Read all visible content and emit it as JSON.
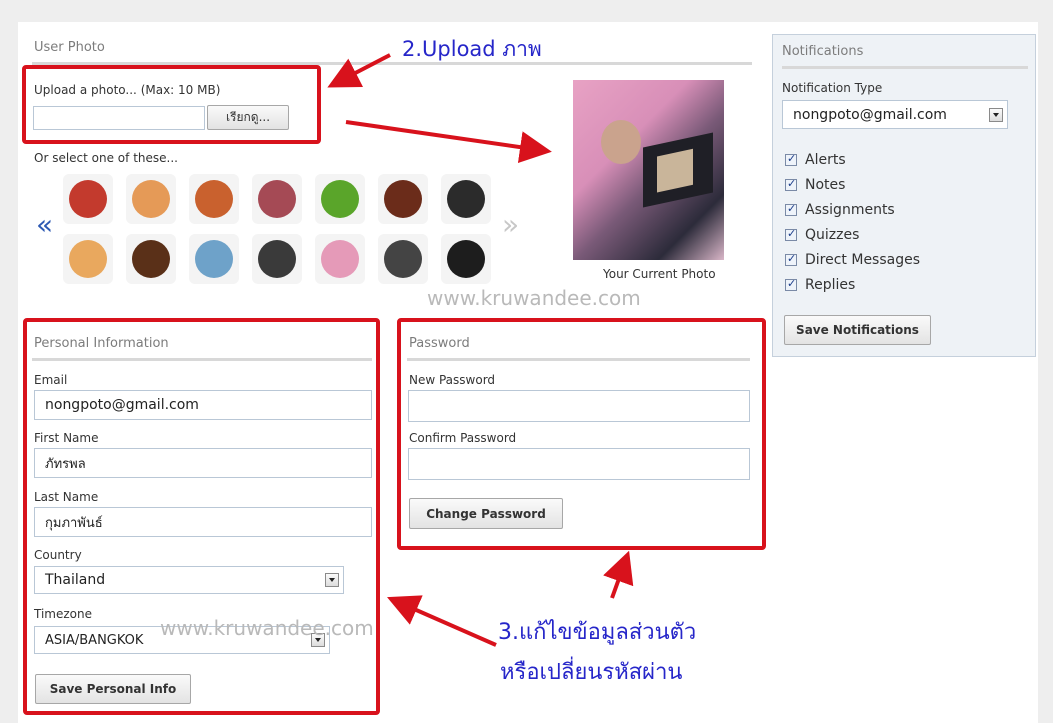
{
  "user_photo": {
    "title": "User Photo",
    "upload_label": "Upload a photo... (Max: 10 MB)",
    "browse_label": "เรียกดู...",
    "or_select_label": "Or select one of these...",
    "prev_glyph": "«",
    "next_glyph": "»",
    "current_photo_caption": "Your Current Photo"
  },
  "avatars": [
    {
      "name": "food-bowl",
      "color": "#c33a2d"
    },
    {
      "name": "boy-face",
      "color": "#e59a57"
    },
    {
      "name": "girl-face",
      "color": "#c9612e"
    },
    {
      "name": "radio",
      "color": "#a54a55"
    },
    {
      "name": "green-car",
      "color": "#5aa52a"
    },
    {
      "name": "woman-face",
      "color": "#6b2c1a"
    },
    {
      "name": "glasses-face",
      "color": "#2b2b2b"
    },
    {
      "name": "man-face",
      "color": "#e9a85e"
    },
    {
      "name": "dark-boy-face",
      "color": "#5a3018"
    },
    {
      "name": "photos",
      "color": "#6ea2c9"
    },
    {
      "name": "safe",
      "color": "#3a3a3a"
    },
    {
      "name": "peace-sign",
      "color": "#e59ab8"
    },
    {
      "name": "headphones",
      "color": "#444444"
    },
    {
      "name": "cartoon-face",
      "color": "#1d1d1d"
    }
  ],
  "personal": {
    "title": "Personal Information",
    "email_label": "Email",
    "email_value": "nongpoto@gmail.com",
    "first_name_label": "First Name",
    "first_name_value": "ภัทรพล",
    "last_name_label": "Last Name",
    "last_name_value": "กุมภาพันธ์",
    "country_label": "Country",
    "country_value": "Thailand",
    "timezone_label": "Timezone",
    "timezone_value": "ASIA/BANGKOK",
    "save_label": "Save Personal Info"
  },
  "password": {
    "title": "Password",
    "new_label": "New Password",
    "new_value": "",
    "confirm_label": "Confirm Password",
    "confirm_value": "",
    "change_label": "Change Password"
  },
  "notifications": {
    "title": "Notifications",
    "type_label": "Notification Type",
    "type_value": "nongpoto@gmail.com",
    "items": [
      {
        "label": "Alerts",
        "checked": true
      },
      {
        "label": "Notes",
        "checked": true
      },
      {
        "label": "Assignments",
        "checked": true
      },
      {
        "label": "Quizzes",
        "checked": true
      },
      {
        "label": "Direct Messages",
        "checked": true
      },
      {
        "label": "Replies",
        "checked": true
      }
    ],
    "save_label": "Save Notifications"
  },
  "annotations": {
    "upload": "2.Upload ภาพ",
    "edit_line1": "3.แก้ไขข้อมูลส่วนตัว",
    "edit_line2": "หรือเปลี่ยนรหัสผ่าน",
    "watermark": "www.kruwandee.com"
  },
  "colors": {
    "annotation_red": "#d8121c",
    "annotation_blue": "#2626c9",
    "notification_panel": "#eef2f6"
  }
}
